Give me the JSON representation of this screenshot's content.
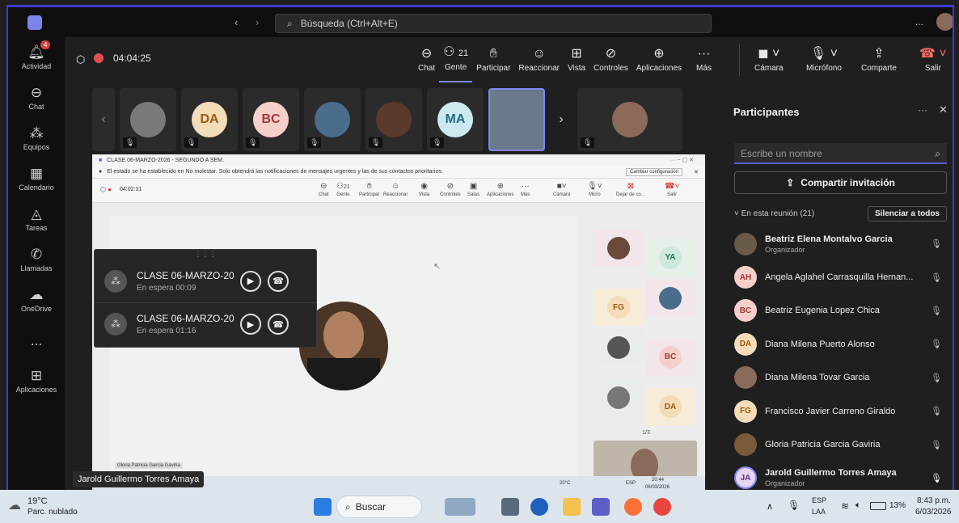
{
  "topbar": {
    "search_placeholder": "Búsqueda (Ctrl+Alt+E)",
    "more": "..."
  },
  "rail": [
    {
      "label": "Actividad",
      "icon": "bell-icon",
      "badge": "4"
    },
    {
      "label": "Chat",
      "icon": "chat-icon"
    },
    {
      "label": "Equipos",
      "icon": "teams-icon"
    },
    {
      "label": "Calendario",
      "icon": "calendar-icon"
    },
    {
      "label": "Tareas",
      "icon": "tasks-icon"
    },
    {
      "label": "Llamadas",
      "icon": "phone-icon"
    },
    {
      "label": "OneDrive",
      "icon": "cloud-icon"
    },
    {
      "label": "...",
      "icon": "more-icon"
    },
    {
      "label": "Aplicaciones",
      "icon": "apps-icon"
    }
  ],
  "meeting": {
    "timer": "04:04:25",
    "buttons": [
      {
        "label": "Chat",
        "icon": "chat-icon"
      },
      {
        "label": "Gente",
        "icon": "people-icon",
        "count": "21"
      },
      {
        "label": "Participar",
        "icon": "hand-icon"
      },
      {
        "label": "Reaccionar",
        "icon": "emoji-icon"
      },
      {
        "label": "Vista",
        "icon": "view-icon"
      },
      {
        "label": "Controles",
        "icon": "controls-icon"
      },
      {
        "label": "Aplicaciones",
        "icon": "add-icon"
      },
      {
        "label": "Más",
        "icon": "more-icon"
      }
    ],
    "camera": "Cámara",
    "mic": "Micrófono",
    "share": "Comparte",
    "leave": "Salir"
  },
  "strip": [
    {
      "initials": "",
      "color": "#7a7a7a"
    },
    {
      "initials": "DA",
      "color": "#f3dcb8",
      "fg": "#9b5a12"
    },
    {
      "initials": "BC",
      "color": "#f5d0cb",
      "fg": "#a4373a"
    },
    {
      "initials": "",
      "color": "#4a6d8c"
    },
    {
      "initials": "",
      "color": "#5a3a2a"
    },
    {
      "initials": "MA",
      "color": "#cde9f0",
      "fg": "#1e6b80"
    },
    {
      "initials": "",
      "color": "#6a7a8a"
    },
    {
      "initials": "",
      "color": "#8c6a5a"
    }
  ],
  "inner": {
    "title": "CLASE 06-MARZO-2026 - SEGUNDO A SEM.",
    "notice": "El estado se ha establecido en No molestar. Solo obtendrá las notificaciones de mensajes urgentes y las de sus contactos prioritarios.",
    "change_config": "Cambiar configuración",
    "timer": "04:02:31",
    "buttons": [
      "Chat",
      "Gente",
      "Participar",
      "Reaccionar",
      "Vista",
      "Controles",
      "Salas",
      "Aplicaciones",
      "Más",
      "Cámara",
      "Micro",
      "Dejar de co...",
      "Salir"
    ],
    "people_count": "21",
    "mini": [
      "",
      "YA",
      "FG",
      "",
      "",
      "BC",
      "",
      "DA"
    ],
    "pager": "1/3",
    "speaker_label": "Gloria Patricia Garcia Gaviria",
    "inner_clock": "20:44",
    "inner_date": "06/03/2026",
    "inner_temp": "20°C",
    "inner_lang": "ESP"
  },
  "call_cards": [
    {
      "title": "CLASE 06-MARZO-2026",
      "status": "En espera  00:09"
    },
    {
      "title": "CLASE 06-MARZO-2026",
      "status": "En espera  01:16"
    }
  ],
  "presenter_label": "Jarold Guillermo Torres Amaya",
  "panel": {
    "title": "Participantes",
    "search_placeholder": "Escribe un nombre",
    "share_invite": "Compartir invitación",
    "section": "En esta reunión (21)",
    "mute_all": "Silenciar a todos",
    "people": [
      {
        "name": "Beatriz Elena Montalvo Garcia",
        "role": "Organizador",
        "initials": "",
        "color": "#6a5a4a"
      },
      {
        "name": "Angela Aglahel Carrasquilla Hernan...",
        "role": "",
        "initials": "AH",
        "color": "#f5d0cb",
        "fg": "#a4373a"
      },
      {
        "name": "Beatriz Eugenia Lopez Chica",
        "role": "",
        "initials": "BC",
        "color": "#f5d0cb",
        "fg": "#a4373a"
      },
      {
        "name": "Diana Milena Puerto Alonso",
        "role": "",
        "initials": "DA",
        "color": "#f3dcb8",
        "fg": "#9b5a12"
      },
      {
        "name": "Diana Milena Tovar Garcia",
        "role": "",
        "initials": "",
        "color": "#8a6a5a"
      },
      {
        "name": "Francisco Javier Carreno Giraldo",
        "role": "",
        "initials": "FG",
        "color": "#f3dcb8",
        "fg": "#9b5a12"
      },
      {
        "name": "Gloria Patricia Garcia Gaviria",
        "role": "",
        "initials": "",
        "color": "#7a5a3a"
      },
      {
        "name": "Jarold Guillermo Torres Amaya",
        "role": "Organizador",
        "initials": "JA",
        "color": "#e5d6ef",
        "fg": "#5c2e91"
      }
    ]
  },
  "taskbar": {
    "weather_temp": "19°C",
    "weather_desc": "Parc. nublado",
    "search": "Buscar",
    "lang1": "ESP",
    "lang2": "LAA",
    "battery": "13%",
    "time": "8:43 p.m.",
    "date": "6/03/2026"
  }
}
